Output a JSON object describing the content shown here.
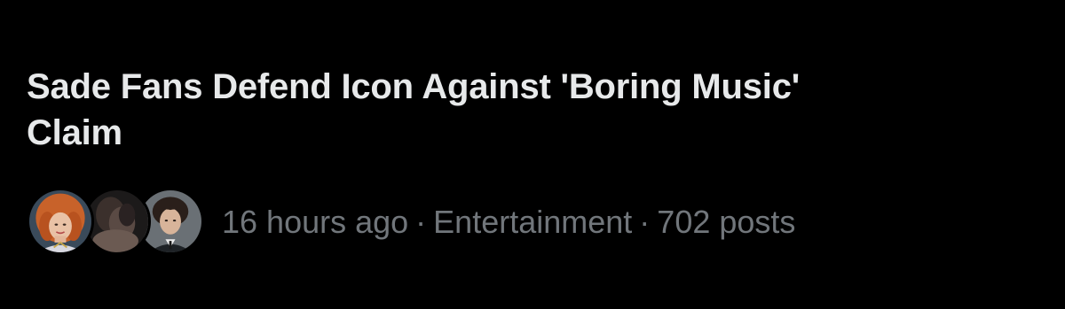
{
  "trend": {
    "title": "Sade Fans Defend Icon Against 'Boring Music' Claim",
    "time_ago": "16 hours ago",
    "separator": "·",
    "category": "Entertainment",
    "post_count": "702 posts"
  },
  "colors": {
    "background": "#000000",
    "title_text": "#e7e9ea",
    "meta_text": "#71767b"
  }
}
